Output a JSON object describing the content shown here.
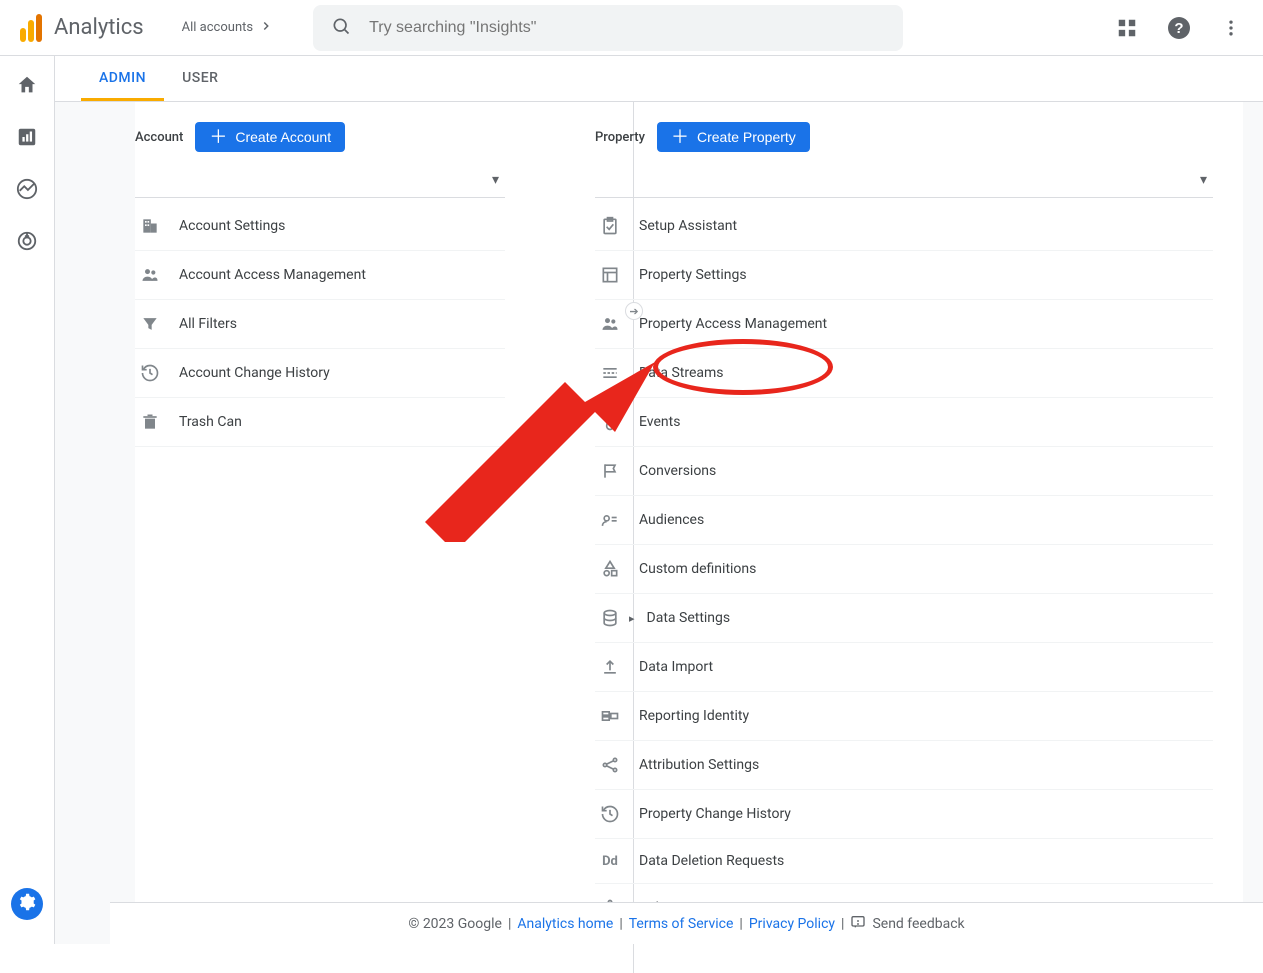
{
  "header": {
    "product": "Analytics",
    "accounts_label": "All accounts",
    "search_placeholder": "Try searching \"Insights\""
  },
  "tabs": {
    "admin": "ADMIN",
    "user": "USER"
  },
  "account_col": {
    "label": "Account",
    "create": "Create Account",
    "items": [
      "Account Settings",
      "Account Access Management",
      "All Filters",
      "Account Change History",
      "Trash Can"
    ]
  },
  "property_col": {
    "label": "Property",
    "create": "Create Property",
    "items": [
      "Setup Assistant",
      "Property Settings",
      "Property Access Management",
      "Data Streams",
      "Events",
      "Conversions",
      "Audiences",
      "Custom definitions",
      "Data Settings",
      "Data Import",
      "Reporting Identity",
      "Attribution Settings",
      "Property Change History",
      "Data Deletion Requests",
      "DebugView"
    ]
  },
  "footer": {
    "copyright": "© 2023 Google",
    "links": [
      "Analytics home",
      "Terms of Service",
      "Privacy Policy"
    ],
    "feedback": "Send feedback"
  }
}
